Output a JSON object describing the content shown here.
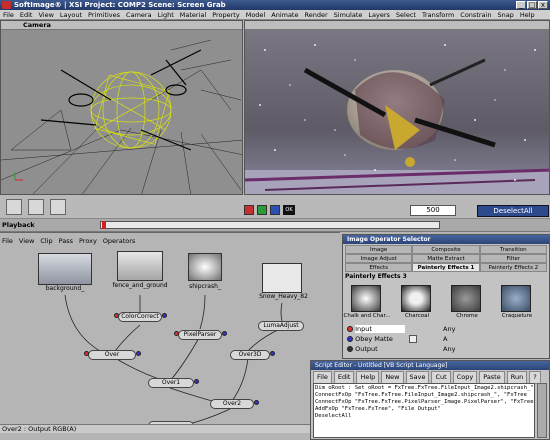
{
  "window": {
    "title": "SoftImage® | XSI Project: COMP2    Scene: Screen Grab",
    "minimize": "_",
    "maximize": "□",
    "close": "x"
  },
  "menu": [
    "File",
    "Edit",
    "View",
    "Layout",
    "Primitives",
    "Camera",
    "Light",
    "Material",
    "Property",
    "Model",
    "Animate",
    "Render",
    "Simulate",
    "Layers",
    "Select",
    "Transform",
    "Constrain",
    "Snap",
    "Help"
  ],
  "viewport_left": {
    "camera_label": "Camera"
  },
  "toolbar": {
    "frame_value": "500",
    "deselect_label": "DeselectAll",
    "ok_label": "OK"
  },
  "playback": {
    "label": "Playback"
  },
  "colors": {
    "red": "#c83030",
    "green": "#2f9a38",
    "blue": "#2c4fb0",
    "black": "#111111",
    "accent": "#2d4a8c"
  },
  "fxtree": {
    "menu": [
      "File",
      "View",
      "Clip",
      "Pass",
      "Proxy",
      "Operators"
    ],
    "nodes": {
      "background": "background_",
      "fence": "fence_and_ground",
      "shipcrash": "shipcrash_",
      "snow": "Snow_Heavy_82",
      "colorcorrect": "ColorCorrect",
      "pixelparser": "PixelParser",
      "lumaadjust": "LumaAdjust",
      "over": "Over",
      "over1": "Over1",
      "over3d": "Over3D",
      "over2": "Over2"
    },
    "status": "Over2 : Output RGB(A)"
  },
  "image_operator_selector": {
    "title": "Image Operator Selector",
    "tabs_row1": [
      "Image",
      "Composite",
      "Transition"
    ],
    "tabs_row2": [
      "Image Adjust",
      "Matte Extract",
      "Filter"
    ],
    "tabs_row3": [
      "Effects",
      "Painterly Effects 1",
      "Painterly Effects 2"
    ],
    "section": "Painterly Effects 3",
    "thumbnails": [
      "Chalk and Char...",
      "Charcoal",
      "Chrome",
      "Craquelure"
    ],
    "ports": [
      {
        "name": "Input",
        "value": "Any"
      },
      {
        "name": "Obey Matte",
        "value": "A"
      },
      {
        "name": "Output",
        "value": "Any"
      }
    ]
  },
  "script_editor": {
    "title": "Script Editor - Untitled [VB Script Language]",
    "buttons": [
      "File",
      "Edit",
      "Help",
      "New",
      "Save",
      "Cut",
      "Copy",
      "Paste",
      "Run",
      "?"
    ],
    "code": [
      "Dim oRoot : Set oRoot = FxTree.FxTree.FileInput_Image2.shipcrash_\", \"FxTree",
      "ConnectFxOp \"FxTree.FxTree.FileInput_Image2.shipcrash_\", \"FxTree",
      "ConnectFxOp \"FxTree.FxTree.PixelParser_Image.PixelParser\", \"FxTree",
      "AddFxOp \"FxTree.FxTree\", \"File Output\"",
      "DeselectAll"
    ]
  }
}
